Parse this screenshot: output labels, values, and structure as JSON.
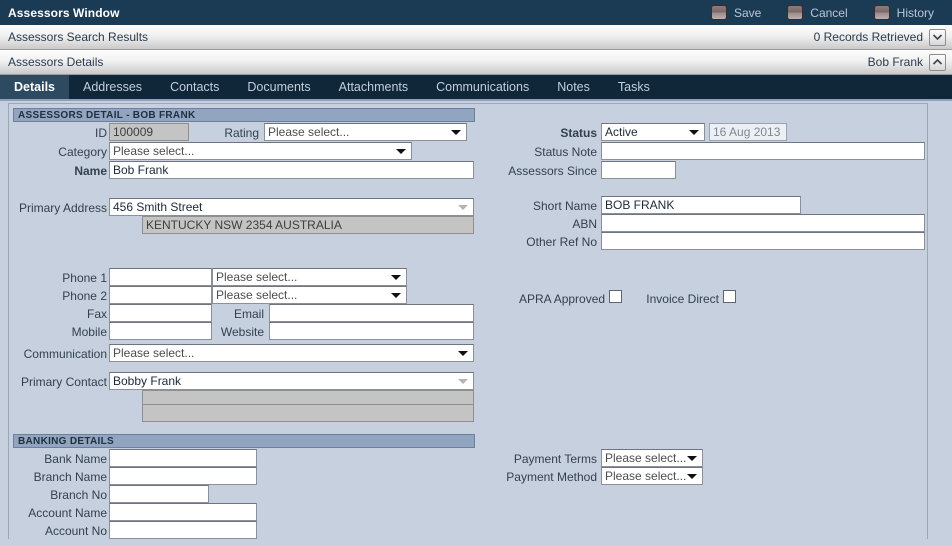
{
  "window": {
    "title": "Assessors Window",
    "actions": [
      {
        "label": "Save",
        "icon": "save-icon"
      },
      {
        "label": "Cancel",
        "icon": "cancel-icon"
      },
      {
        "label": "History",
        "icon": "history-icon"
      }
    ]
  },
  "search_bar": {
    "label": "Assessors Search Results",
    "records": "0 Records Retrieved",
    "toggle_icon": "chevron-down-icon"
  },
  "details_bar": {
    "label": "Assessors Details",
    "record_name": "Bob Frank",
    "toggle_icon": "chevron-up-icon"
  },
  "tabs": [
    {
      "label": "Details",
      "active": true
    },
    {
      "label": "Addresses",
      "active": false
    },
    {
      "label": "Contacts",
      "active": false
    },
    {
      "label": "Documents",
      "active": false
    },
    {
      "label": "Attachments",
      "active": false
    },
    {
      "label": "Communications",
      "active": false
    },
    {
      "label": "Notes",
      "active": false
    },
    {
      "label": "Tasks",
      "active": false
    }
  ],
  "detail_section": {
    "heading": "ASSESSORS DETAIL - BOB FRANK",
    "id_label": "ID",
    "id_value": "100009",
    "rating_label": "Rating",
    "rating_value": "Please select...",
    "category_label": "Category",
    "category_value": "Please select...",
    "name_label": "Name",
    "name_value": "Bob Frank",
    "primary_address_label": "Primary Address",
    "primary_address_value": "456 Smith Street",
    "primary_address_line2": "KENTUCKY NSW 2354 AUSTRALIA",
    "status_label": "Status",
    "status_value": "Active",
    "status_date": "16 Aug 2013",
    "status_note_label": "Status Note",
    "status_note_value": "",
    "assessors_since_label": "Assessors Since",
    "assessors_since_value": "",
    "short_name_label": "Short Name",
    "short_name_value": "BOB FRANK",
    "abn_label": "ABN",
    "abn_value": "",
    "other_ref_label": "Other Ref No",
    "other_ref_value": "",
    "phone1_label": "Phone 1",
    "phone1_value": "",
    "phone1_type": "Please select...",
    "phone2_label": "Phone 2",
    "phone2_value": "",
    "phone2_type": "Please select...",
    "fax_label": "Fax",
    "fax_value": "",
    "email_label": "Email",
    "email_value": "",
    "mobile_label": "Mobile",
    "mobile_value": "",
    "website_label": "Website",
    "website_value": "",
    "communication_label": "Communication",
    "communication_value": "Please select...",
    "primary_contact_label": "Primary Contact",
    "primary_contact_value": "Bobby Frank",
    "primary_contact_line2": "",
    "primary_contact_line3": "",
    "apra_label": "APRA Approved",
    "apra_checked": false,
    "invoice_direct_label": "Invoice Direct",
    "invoice_direct_checked": false
  },
  "banking_section": {
    "heading": "BANKING DETAILS",
    "bank_name_label": "Bank Name",
    "bank_name_value": "",
    "branch_name_label": "Branch Name",
    "branch_name_value": "",
    "branch_no_label": "Branch No",
    "branch_no_value": "",
    "account_name_label": "Account Name",
    "account_name_value": "",
    "account_no_label": "Account No",
    "account_no_value": "",
    "payment_terms_label": "Payment Terms",
    "payment_terms_value": "Please select...",
    "payment_method_label": "Payment Method",
    "payment_method_value": "Please select..."
  },
  "colors": {
    "titlebar": "#1b3b55",
    "tabstrip": "#0f2738",
    "active_tab": "#2e4a60",
    "body_bg": "#c7d0de",
    "section_header": "#92a5c0"
  }
}
